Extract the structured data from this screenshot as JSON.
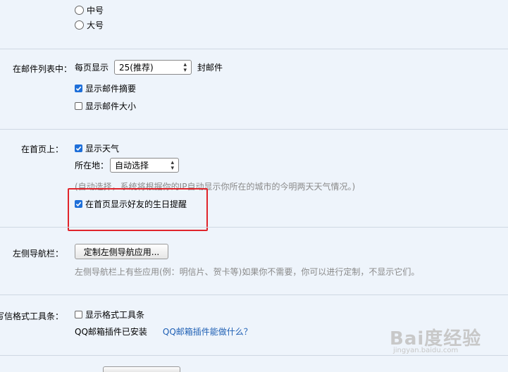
{
  "font_size": {
    "medium_label": "中号",
    "large_label": "大号"
  },
  "mail_list": {
    "section_label": "在邮件列表中：",
    "per_page_prefix": "每页显示",
    "per_page_value": "25(推荐)",
    "per_page_suffix": "封邮件",
    "show_summary_label": "显示邮件摘要",
    "show_summary_checked": true,
    "show_size_label": "显示邮件大小",
    "show_size_checked": false
  },
  "homepage": {
    "section_label": "在首页上：",
    "show_weather_label": "显示天气",
    "show_weather_checked": true,
    "location_label": "所在地：",
    "location_value": "自动选择",
    "location_hint": "(自动选择，系统将根据你的IP自动显示你所在的城市的今明两天天气情况。)",
    "birthday_label": "在首页显示好友的生日提醒",
    "birthday_checked": true
  },
  "left_nav": {
    "section_label": "左侧导航栏：",
    "customize_button": "定制左侧导航应用...",
    "hint": "左侧导航栏上有些应用(例：明信片、贺卡等)如果你不需要，你可以进行定制，不显示它们。"
  },
  "rich_text": {
    "section_label": "写信格式工具条：",
    "show_toolbar_label": "显示格式工具条",
    "show_toolbar_checked": false,
    "plugin_status": "QQ邮箱插件已安装",
    "plugin_link": "QQ邮箱插件能做什么？"
  },
  "colors": {
    "highlight": "#e0242b",
    "link": "#1e5fb4",
    "checkbox_on": "#1e6fd9"
  },
  "watermark": {
    "brand": "Bai度经验",
    "url": "jingyan.baidu.com"
  }
}
